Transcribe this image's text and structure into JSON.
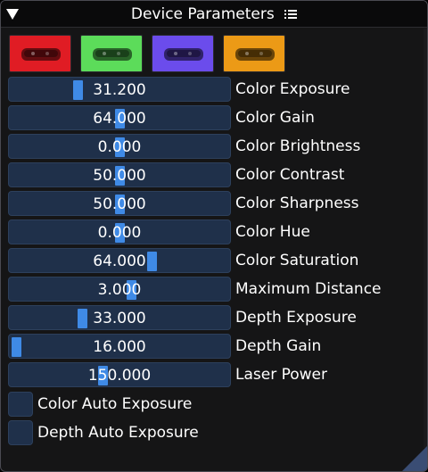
{
  "window": {
    "title": "Device Parameters",
    "menu_icon": "list-icon"
  },
  "swatches": [
    {
      "name": "red",
      "color": "#e01c24"
    },
    {
      "name": "green",
      "color": "#5cdc5a"
    },
    {
      "name": "blue",
      "color": "#6b4cec"
    },
    {
      "name": "orange",
      "color": "#ec9a16"
    }
  ],
  "sliders": [
    {
      "label": "Color Exposure",
      "value": "31.200",
      "fill": 0.3
    },
    {
      "label": "Color Gain",
      "value": "64.000",
      "fill": 0.5
    },
    {
      "label": "Color Brightness",
      "value": "0.000",
      "fill": 0.5
    },
    {
      "label": "Color Contrast",
      "value": "50.000",
      "fill": 0.5
    },
    {
      "label": "Color Sharpness",
      "value": "50.000",
      "fill": 0.5
    },
    {
      "label": "Color Hue",
      "value": "0.000",
      "fill": 0.5
    },
    {
      "label": "Color Saturation",
      "value": "64.000",
      "fill": 0.66
    },
    {
      "label": "Maximum Distance",
      "value": "3.000",
      "fill": 0.56
    },
    {
      "label": "Depth Exposure",
      "value": "33.000",
      "fill": 0.32
    },
    {
      "label": "Depth Gain",
      "value": "16.000",
      "fill": 0.0
    },
    {
      "label": "Laser Power",
      "value": "150.000",
      "fill": 0.42
    }
  ],
  "checkboxes": [
    {
      "label": "Color Auto Exposure",
      "checked": false
    },
    {
      "label": "Depth Auto Exposure",
      "checked": false
    }
  ],
  "colors": {
    "slider_bg": "#1f304a",
    "grab": "#3f8ae6",
    "window_bg": "#151516"
  }
}
